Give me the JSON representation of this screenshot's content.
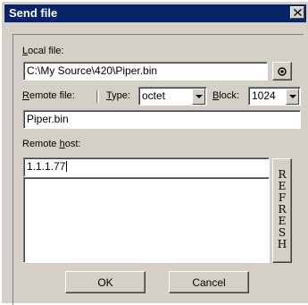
{
  "window": {
    "title": "Send file",
    "close_glyph": "✕"
  },
  "local_file": {
    "label": "Local file:",
    "value": "C:\\My Source\\420\\Piper.bin",
    "browse_icon": "browse-icon"
  },
  "remote_file": {
    "label": "Remote file:",
    "value": "Piper.bin"
  },
  "type": {
    "label": "Type:",
    "selected": "octet"
  },
  "block": {
    "label": "Block:",
    "selected": "1024"
  },
  "remote_host": {
    "label": "Remote host:",
    "value": "1.1.1.77"
  },
  "refresh_button": {
    "letters": [
      "R",
      "E",
      "F",
      "R",
      "E",
      "S",
      "H"
    ]
  },
  "buttons": {
    "ok": "OK",
    "cancel": "Cancel"
  }
}
